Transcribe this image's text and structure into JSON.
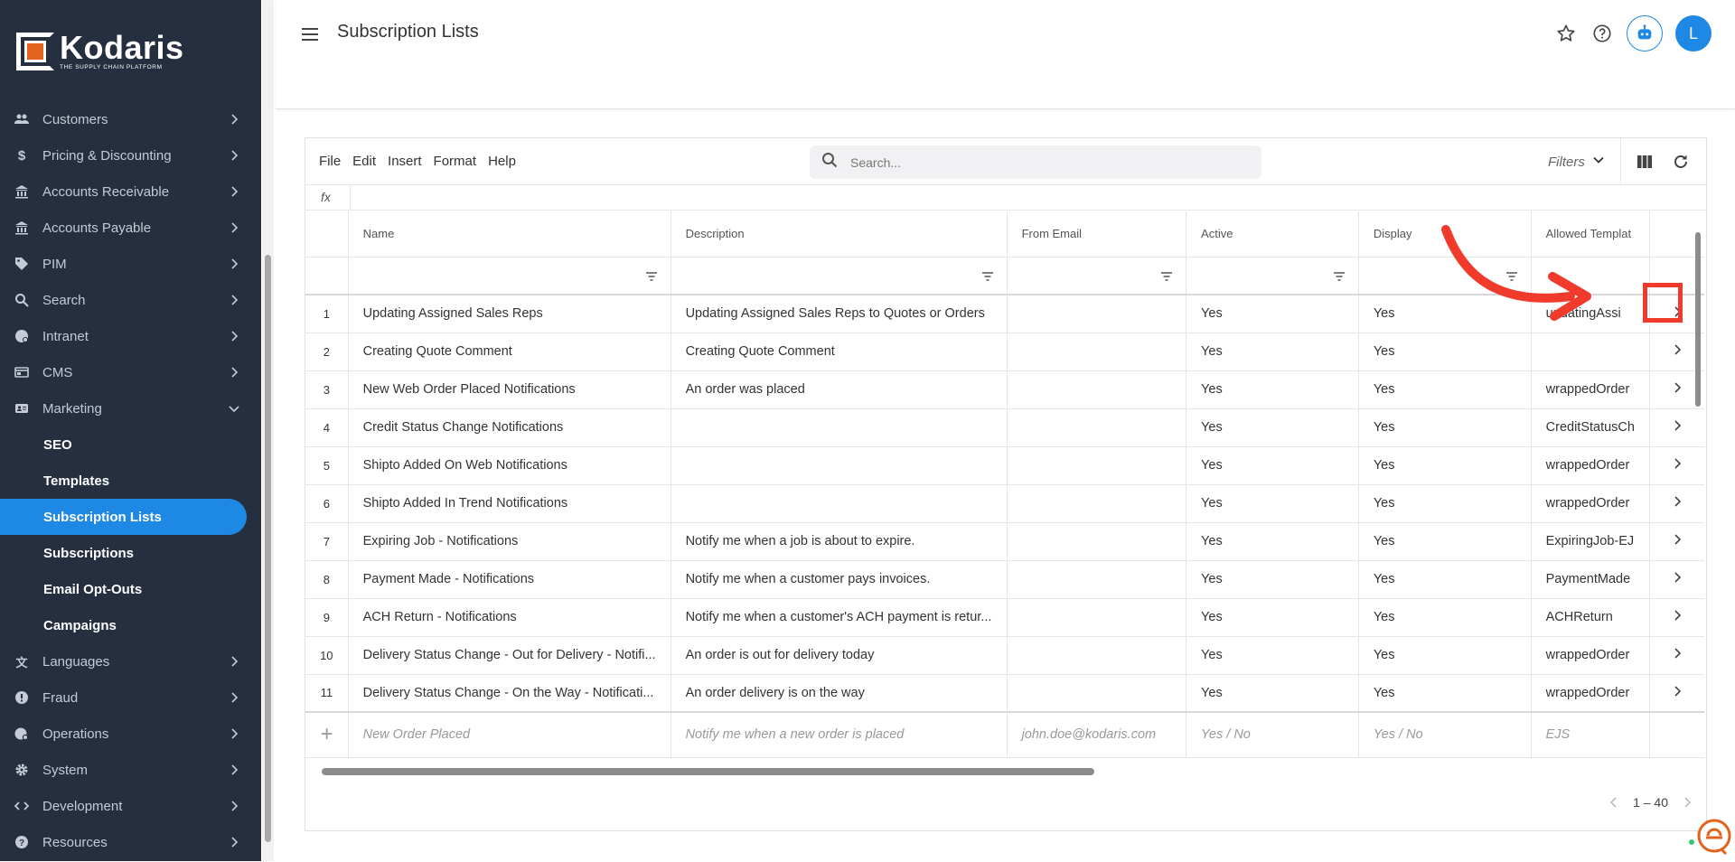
{
  "brand": {
    "name": "Kodaris",
    "tagline": "THE SUPPLY CHAIN PLATFORM"
  },
  "sidebar": {
    "items": [
      {
        "label": "Customers",
        "icon": "people-icon"
      },
      {
        "label": "Pricing & Discounting",
        "icon": "dollar-icon"
      },
      {
        "label": "Accounts Receivable",
        "icon": "bank-icon"
      },
      {
        "label": "Accounts Payable",
        "icon": "bank-icon"
      },
      {
        "label": "PIM",
        "icon": "tag-icon"
      },
      {
        "label": "Search",
        "icon": "search-icon"
      },
      {
        "label": "Intranet",
        "icon": "intranet-icon"
      },
      {
        "label": "CMS",
        "icon": "cms-icon"
      },
      {
        "label": "Marketing",
        "icon": "marketing-icon"
      }
    ],
    "marketing_sub": [
      "SEO",
      "Templates",
      "Subscription Lists",
      "Subscriptions",
      "Email Opt-Outs",
      "Campaigns"
    ],
    "items_after": [
      {
        "label": "Languages",
        "icon": "translate-icon"
      },
      {
        "label": "Fraud",
        "icon": "alert-icon"
      },
      {
        "label": "Operations",
        "icon": "operations-icon"
      },
      {
        "label": "System",
        "icon": "gear-icon"
      },
      {
        "label": "Development",
        "icon": "code-icon"
      },
      {
        "label": "Resources",
        "icon": "help-icon"
      }
    ],
    "active": "Subscription Lists"
  },
  "header": {
    "title": "Subscription Lists",
    "avatar_initial": "L"
  },
  "toolbar": {
    "menus": [
      "File",
      "Edit",
      "Insert",
      "Format",
      "Help"
    ],
    "search_placeholder": "Search...",
    "filters_label": "Filters"
  },
  "formula_bar": {
    "label": "fx"
  },
  "table": {
    "columns": [
      "Name",
      "Description",
      "From Email",
      "Active",
      "Display",
      "Allowed Templat"
    ],
    "rows": [
      [
        "1",
        "Updating Assigned Sales Reps",
        "Updating Assigned Sales Reps to Quotes or Orders",
        "",
        "Yes",
        "Yes",
        "updatingAssi"
      ],
      [
        "2",
        "Creating Quote Comment",
        "Creating Quote Comment",
        "",
        "Yes",
        "Yes",
        ""
      ],
      [
        "3",
        "New Web Order Placed Notifications",
        "An order was placed",
        "",
        "Yes",
        "Yes",
        "wrappedOrder"
      ],
      [
        "4",
        "Credit Status Change Notifications",
        "",
        "",
        "Yes",
        "Yes",
        "CreditStatusCh"
      ],
      [
        "5",
        "Shipto Added On Web Notifications",
        "",
        "",
        "Yes",
        "Yes",
        "wrappedOrder"
      ],
      [
        "6",
        "Shipto Added In Trend Notifications",
        "",
        "",
        "Yes",
        "Yes",
        "wrappedOrder"
      ],
      [
        "7",
        "Expiring Job - Notifications",
        "Notify me when a job is about to expire.",
        "",
        "Yes",
        "Yes",
        "ExpiringJob-EJ"
      ],
      [
        "8",
        "Payment Made - Notifications",
        "Notify me when a customer pays invoices.",
        "",
        "Yes",
        "Yes",
        "PaymentMade"
      ],
      [
        "9",
        "ACH Return - Notifications",
        "Notify me when a customer's ACH payment is retur...",
        "",
        "Yes",
        "Yes",
        "ACHReturn"
      ],
      [
        "10",
        "Delivery Status Change - Out for Delivery - Notifi...",
        "An order is out for delivery today",
        "",
        "Yes",
        "Yes",
        "wrappedOrder"
      ],
      [
        "11",
        "Delivery Status Change - On the Way - Notificati...",
        "An order delivery is on the way",
        "",
        "Yes",
        "Yes",
        "wrappedOrder"
      ]
    ],
    "new_row": [
      "New Order Placed",
      "Notify me when a new order is placed",
      "john.doe@kodaris.com",
      "Yes / No",
      "Yes / No",
      "EJS"
    ]
  },
  "pager": {
    "range": "1 – 40"
  },
  "colors": {
    "accent": "#1e88e5",
    "sidebar_bg": "#252f3f",
    "annotation": "#f03a2c"
  }
}
